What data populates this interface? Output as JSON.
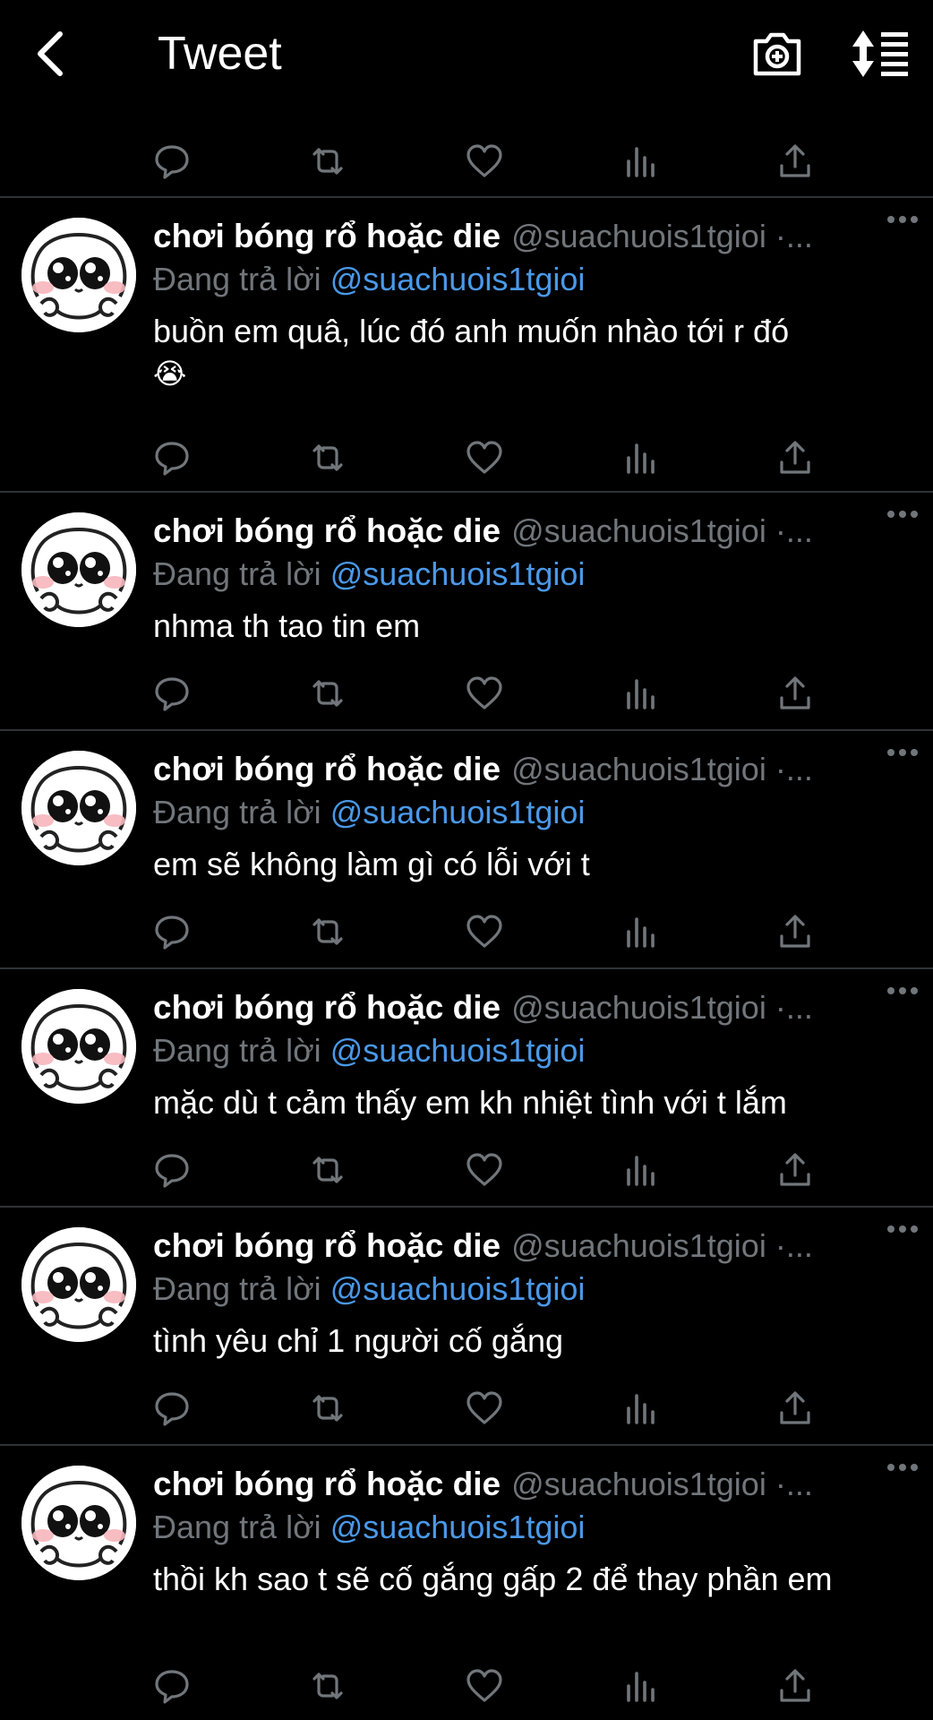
{
  "header": {
    "title": "Tweet"
  },
  "tweets": [
    {
      "name": "chơi bóng rổ hoặc die",
      "handle": "@suachuois1tgioi ·...",
      "reply_prefix": "Đang trả lời ",
      "reply_to": "@suachuois1tgioi",
      "text": "buồn em quâ, lúc đó anh muốn nhào tới r đó",
      "emoji": "😭"
    },
    {
      "name": "chơi bóng rổ hoặc die",
      "handle": "@suachuois1tgioi ·...",
      "reply_prefix": "Đang trả lời ",
      "reply_to": "@suachuois1tgioi",
      "text": "nhma th tao tin em"
    },
    {
      "name": "chơi bóng rổ hoặc die",
      "handle": "@suachuois1tgioi ·...",
      "reply_prefix": "Đang trả lời ",
      "reply_to": "@suachuois1tgioi",
      "text": "em sẽ không làm gì có lỗi với t"
    },
    {
      "name": "chơi bóng rổ hoặc die",
      "handle": "@suachuois1tgioi ·...",
      "reply_prefix": "Đang trả lời ",
      "reply_to": "@suachuois1tgioi",
      "text": "mặc dù t cảm thấy em kh nhiệt tình với t lắm"
    },
    {
      "name": "chơi bóng rổ hoặc die",
      "handle": "@suachuois1tgioi ·...",
      "reply_prefix": "Đang trả lời ",
      "reply_to": "@suachuois1tgioi",
      "text": "tình yêu chỉ 1 người cố gắng"
    },
    {
      "name": "chơi bóng rổ hoặc die",
      "handle": "@suachuois1tgioi ·...",
      "reply_prefix": "Đang trả lời ",
      "reply_to": "@suachuois1tgioi",
      "text": "thồi kh sao t sẽ cố gắng gấp 2 để thay phần em"
    }
  ],
  "colors": {
    "background": "#000000",
    "mention": "#4a99e9",
    "muted": "#71767b",
    "divider": "#2f3336"
  }
}
